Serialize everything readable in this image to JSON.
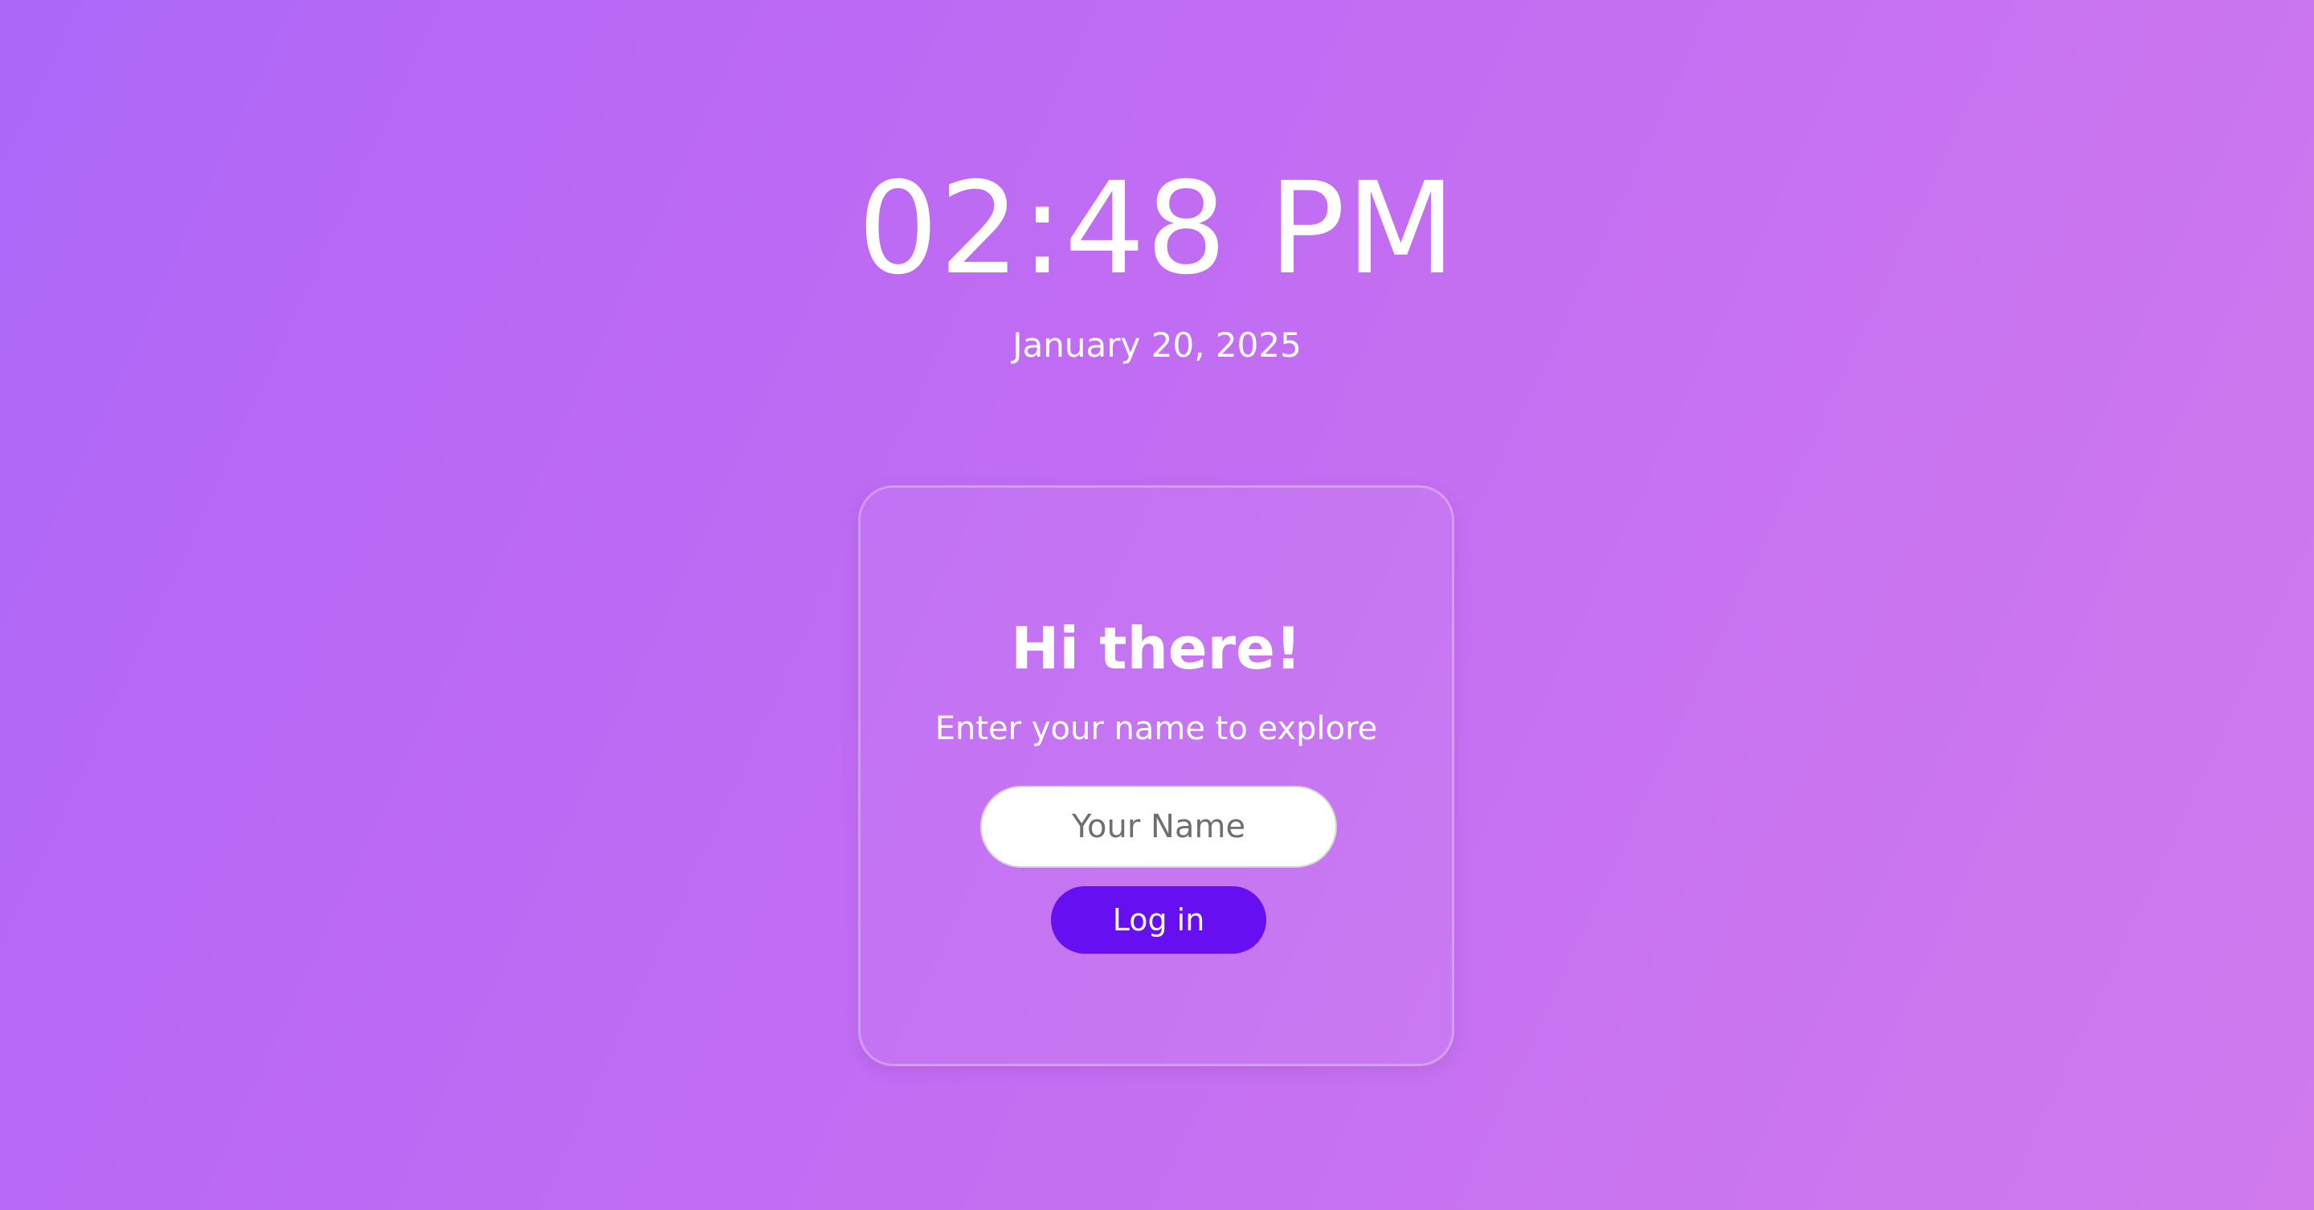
{
  "clock": {
    "time": "02:48 PM",
    "date": "January 20, 2025"
  },
  "login_card": {
    "greeting": "Hi there!",
    "prompt": "Enter your name to explore",
    "name_input": {
      "value": "",
      "placeholder": "Your Name"
    },
    "login_button_label": "Log in"
  },
  "colors": {
    "background_start": "#ad68f7",
    "background_end": "#d07aee",
    "button": "#6610f2",
    "text": "#ffffff"
  }
}
